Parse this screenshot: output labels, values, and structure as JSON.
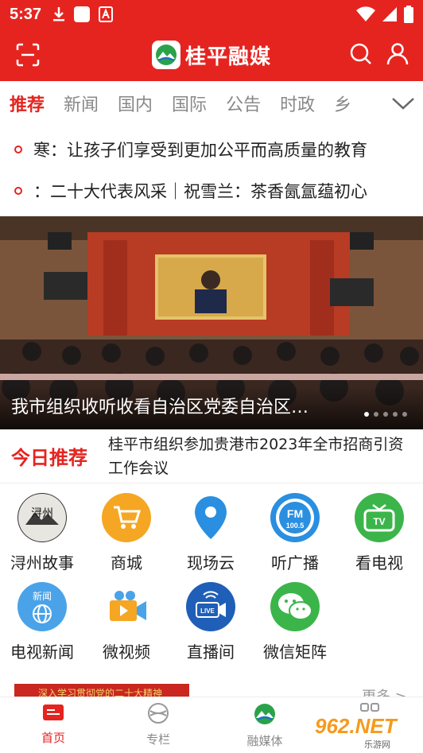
{
  "status": {
    "time": "5:37"
  },
  "app": {
    "title": "桂平融媒"
  },
  "tabs": [
    "推荐",
    "新闻",
    "国内",
    "国际",
    "公告",
    "时政",
    "乡"
  ],
  "ticker": [
    "寒：让孩子们享受到更加公平而高质量的教育",
    "：二十大代表风采｜祝雪兰：茶香氤氲蕴初心"
  ],
  "banner": {
    "caption": "我市组织收听收看自治区党委自治区…"
  },
  "today": {
    "label": "今日推荐",
    "text": "桂平市组织参加贵港市2023年全市招商引资工作会议"
  },
  "services": [
    {
      "label": "浔州故事",
      "icon": "xunzhou-story-icon"
    },
    {
      "label": "商城",
      "icon": "shopping-cart-icon"
    },
    {
      "label": "现场云",
      "icon": "location-pin-icon"
    },
    {
      "label": "听广播",
      "icon": "fm-radio-icon"
    },
    {
      "label": "看电视",
      "icon": "tv-icon"
    },
    {
      "label": "电视新闻",
      "icon": "news-globe-icon"
    },
    {
      "label": "微视频",
      "icon": "video-camera-icon"
    },
    {
      "label": "直播间",
      "icon": "live-camera-icon"
    },
    {
      "label": "微信矩阵",
      "icon": "wechat-icon"
    }
  ],
  "fm_badge": {
    "top": "FM",
    "freq": "100.5"
  },
  "tv_badge": "TV",
  "news_badge": "新闻",
  "live_badge": "LIVE",
  "more": {
    "thumb_text": "深入学习贯彻党的二十大精神",
    "label": "更多 >"
  },
  "bottom_nav": [
    {
      "label": "首页",
      "icon": "home-icon"
    },
    {
      "label": "专栏",
      "icon": "column-icon"
    },
    {
      "label": "融媒体",
      "icon": "media-icon"
    },
    {
      "label": "",
      "icon": "grid-icon"
    }
  ],
  "watermark": {
    "text": "962.NET",
    "sub": "乐游网"
  },
  "colors": {
    "brand_red": "#e52420",
    "orange": "#f5a623",
    "blue": "#2a8fe0",
    "green": "#3bb54a"
  }
}
